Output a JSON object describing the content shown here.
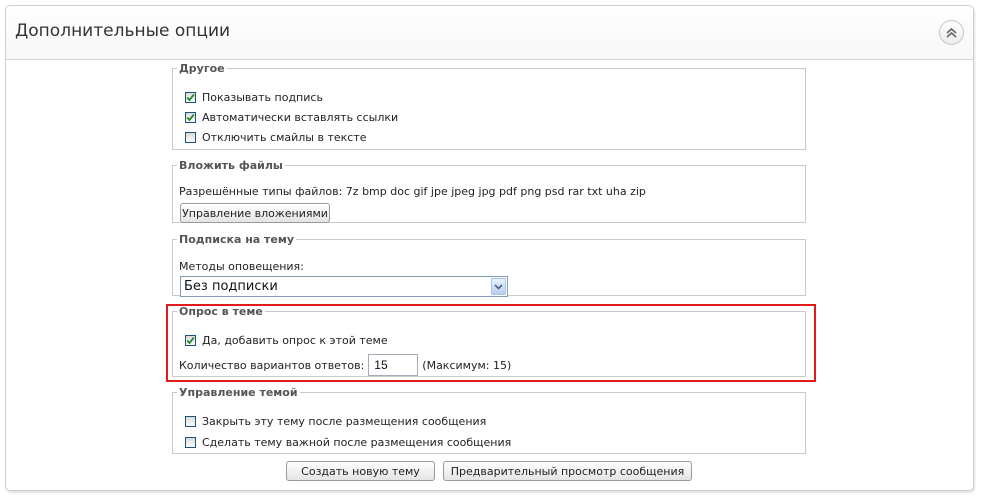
{
  "panel": {
    "title": "Дополнительные опции",
    "collapse_icon": "double-chevron-up-icon"
  },
  "other": {
    "legend": "Другое",
    "options": [
      {
        "label": "Показывать подпись",
        "checked": true
      },
      {
        "label": "Автоматически вставлять ссылки",
        "checked": true
      },
      {
        "label": "Отключить смайлы в тексте",
        "checked": false
      }
    ]
  },
  "attachments": {
    "legend": "Вложить файлы",
    "allowed_types": "Разрешённые типы файлов: 7z bmp doc gif jpe jpeg jpg pdf png psd rar txt uha zip",
    "manage_button": "Управление вложениями"
  },
  "subscription": {
    "legend": "Подписка на тему",
    "methods_label": "Методы оповещения:",
    "selected": "Без подписки"
  },
  "poll": {
    "legend": "Опрос в теме",
    "add_poll": {
      "label": "Да, добавить опрос к этой теме",
      "checked": true
    },
    "options_count_label": "Количество вариантов ответов:",
    "options_count_value": "15",
    "max_note": "(Максимум: 15)",
    "highlight_color": "#e01b1b"
  },
  "topic_management": {
    "legend": "Управление темой",
    "options": [
      {
        "label": "Закрыть эту тему после размещения сообщения",
        "checked": false
      },
      {
        "label": "Сделать тему важной после размещения сообщения",
        "checked": false
      }
    ]
  },
  "actions": {
    "create_topic": "Создать новую тему",
    "preview": "Предварительный просмотр сообщения"
  }
}
